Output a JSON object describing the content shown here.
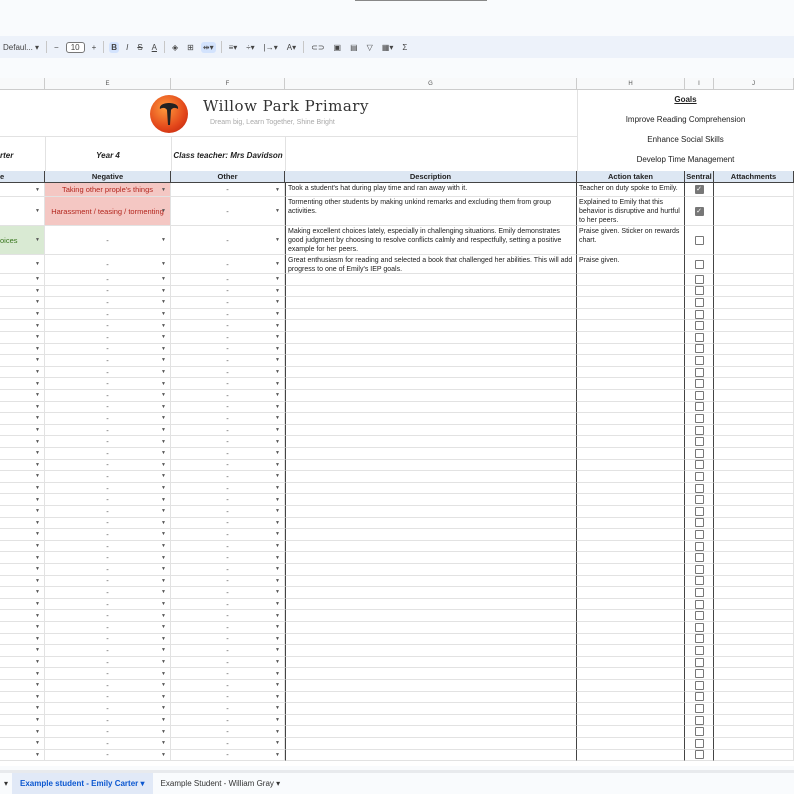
{
  "toolbar": {
    "font": "Defaul...",
    "font_size": "10",
    "icons": [
      "minus-icon",
      "plus-icon",
      "bold-icon",
      "italic-icon",
      "strikethrough-icon",
      "text-color-icon",
      "fill-color-icon",
      "borders-icon",
      "merge-cells-icon",
      "align-icon",
      "valign-icon",
      "text-rotation-icon",
      "text-wrap-icon",
      "link-icon",
      "comment-icon",
      "chart-icon",
      "filter-icon",
      "filter-views-icon",
      "functions-icon"
    ]
  },
  "columns": [
    "E",
    "F",
    "G",
    "H",
    "I",
    "J"
  ],
  "header": {
    "school": "Willow Park Primary",
    "tagline": "Dream big, Learn Together, Shine Bright",
    "student_partial": "rter",
    "year": "Year 4",
    "teacher": "Class teacher: Mrs Davidson"
  },
  "goals": {
    "title": "Goals",
    "items": [
      "Improve Reading Comprehension",
      "Enhance Social Skills",
      "Develop Time Management"
    ]
  },
  "table_headers": {
    "d_partial": "e",
    "negative": "Negative",
    "other": "Other",
    "description": "Description",
    "action": "Action taken",
    "sentral": "Sentral",
    "attachments": "Attachments"
  },
  "rows": [
    {
      "positive": "",
      "negative": "Taking other prople's things",
      "other": "-",
      "description": "Took a student's hat during play time and ran away with it.",
      "action": "Teacher on duty spoke to Emily.",
      "sentral": true
    },
    {
      "positive": "",
      "negative": "Harassment / teasing / tormenting",
      "other": "-",
      "description": "Tormenting other students by making unkind remarks and excluding them from group activities.",
      "action": "Explained to Emily that this behavior is disruptive and hurtful to her peers.",
      "sentral": true
    },
    {
      "positive": "oices",
      "negative": "-",
      "other": "-",
      "description": "Making excellent choices lately, especially in challenging situations. Emily demonstrates good judgment by choosing to resolve conflicts calmly and respectfully, setting a positive example for her peers.",
      "action": "Praise given. Sticker on rewards chart.",
      "sentral": false
    },
    {
      "positive": "",
      "negative": "-",
      "other": "-",
      "description": "Great enthusiasm for reading and selected a book that challenged her abilities. This will add progress to one of Emily's IEP goals.",
      "action": "Praise given.",
      "sentral": false
    }
  ],
  "empty_value": "-",
  "empty_row_count": 42,
  "sheet_tabs": [
    {
      "label": "Example student - Emily Carter",
      "active": true
    },
    {
      "label": "Example Student - William Gray",
      "active": false
    }
  ],
  "colors": {
    "negative_bg": "#f4c7c3",
    "positive_bg": "#d9ead3",
    "header_bg": "#dde7f3",
    "active_tab": "#0b57d0"
  }
}
